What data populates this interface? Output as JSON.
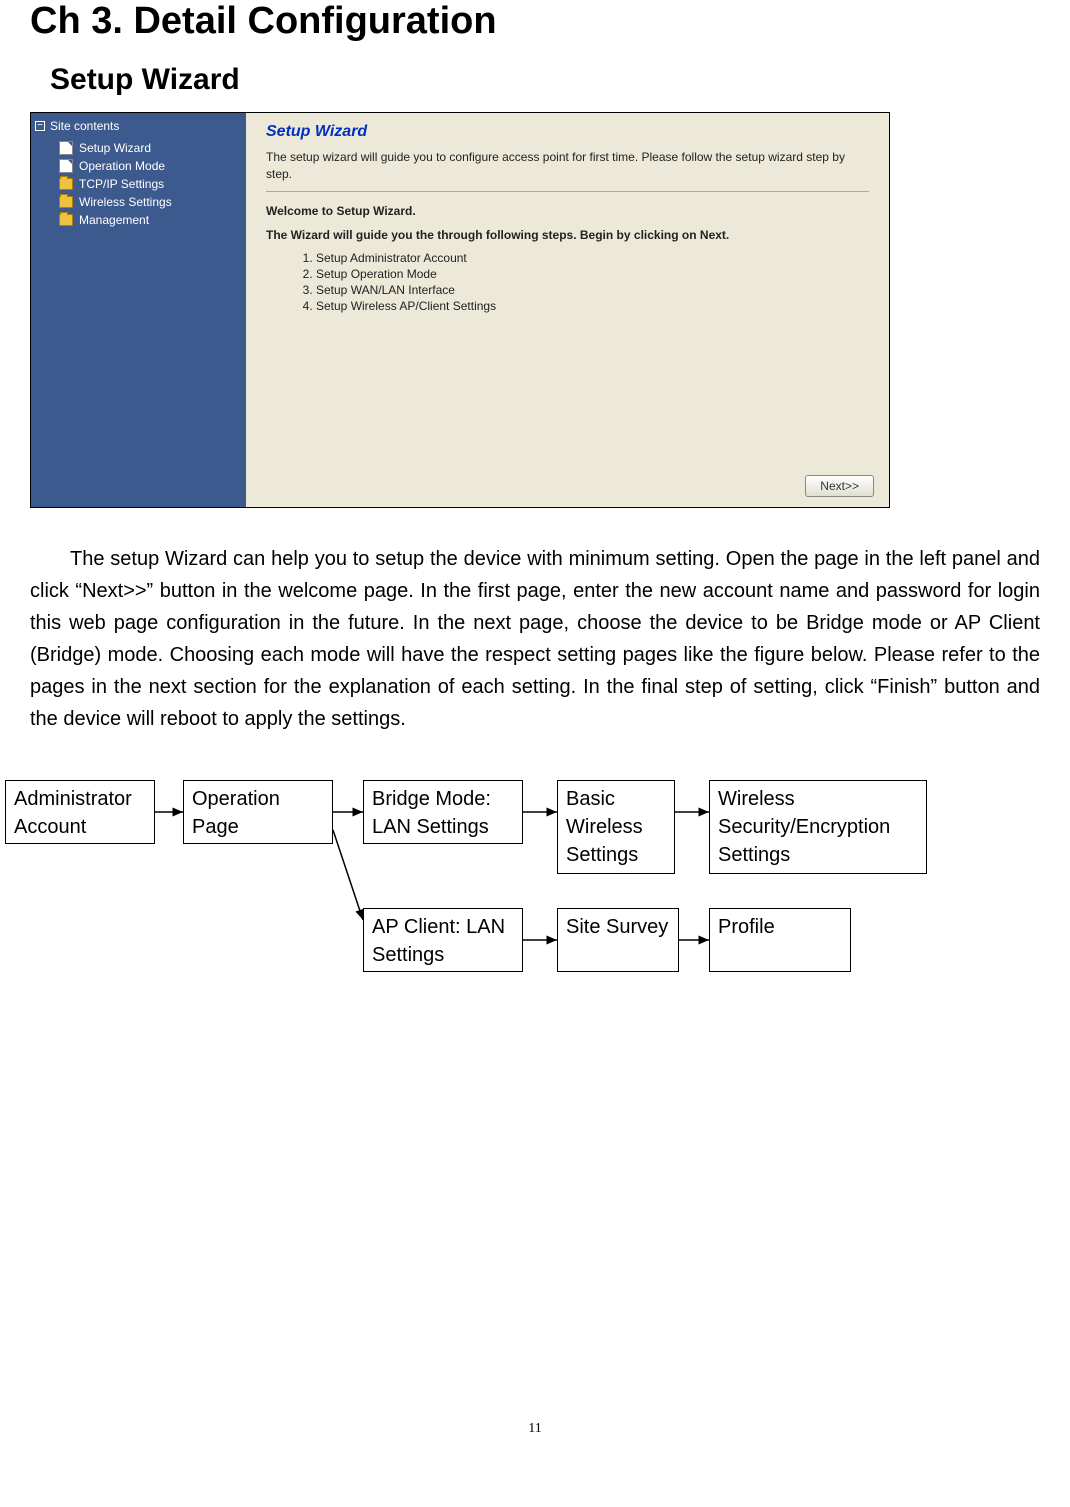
{
  "headings": {
    "chapter": "Ch 3. Detail Configuration",
    "section": "Setup Wizard"
  },
  "screenshot": {
    "sidebar": {
      "title": "Site contents",
      "items": [
        {
          "label": "Setup Wizard",
          "kind": "page"
        },
        {
          "label": "Operation Mode",
          "kind": "page"
        },
        {
          "label": "TCP/IP Settings",
          "kind": "folder"
        },
        {
          "label": "Wireless Settings",
          "kind": "folder"
        },
        {
          "label": "Management",
          "kind": "folder"
        }
      ]
    },
    "main": {
      "title": "Setup Wizard",
      "desc": "The setup wizard will guide you to configure access point for first time. Please follow the setup wizard step by step.",
      "welcome": "Welcome to Setup Wizard.",
      "guide": "The Wizard will guide you the through following steps. Begin by clicking on Next.",
      "steps": [
        "Setup Administrator Account",
        "Setup Operation Mode",
        "Setup WAN/LAN Interface",
        "Setup Wireless AP/Client Settings"
      ],
      "next_btn": "Next>>"
    }
  },
  "paragraph": "The setup Wizard can help you to setup the device with minimum setting. Open the page in the left panel and click “Next>>” button in the welcome page. In the first page, enter the new account name and password for login this web page configuration in the future. In the next page, choose the device to be Bridge mode or AP Client (Bridge) mode. Choosing each mode will have the respect setting pages like the figure below. Please refer to the pages in the next section for the explanation of each setting. In the final step of setting, click “Finish” button and the device will reboot to apply the settings.",
  "diagram": {
    "admin": "Administrator Account",
    "op": "Operation Page",
    "bridge": "Bridge Mode: LAN Settings",
    "basic": "Basic Wireless Settings",
    "sec": "Wireless Security/Encryption Settings",
    "apclient": "AP Client: LAN Settings",
    "survey": "Site Survey",
    "profile": "Profile"
  },
  "page_number": "11"
}
